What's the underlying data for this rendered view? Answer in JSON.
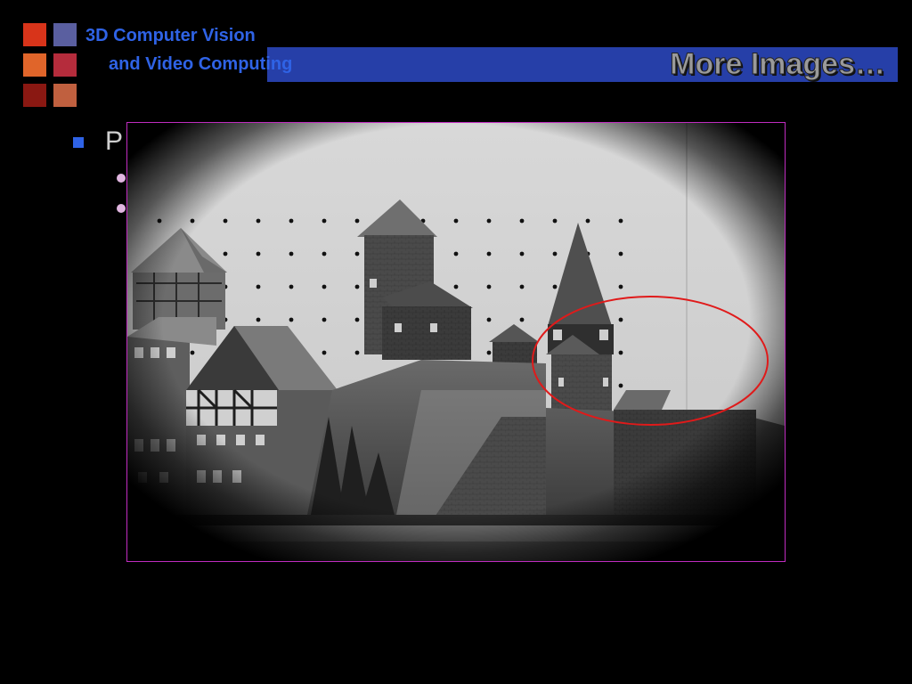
{
  "header": {
    "line1": "3D Computer Vision",
    "line2": "and Video Computing",
    "title": "More Images…"
  },
  "logo": {
    "colors": [
      "#d8341a",
      "#5a5fa0",
      "#e0652a",
      "#b52c3c",
      "#8a1812",
      "#c0603f"
    ]
  },
  "body": {
    "bullet_text": "P",
    "sub_bullet_count": 2
  },
  "image": {
    "description_icon": "castle-photo",
    "annotation_color": "#e01a1a",
    "frame_color": "#c02cc0"
  }
}
